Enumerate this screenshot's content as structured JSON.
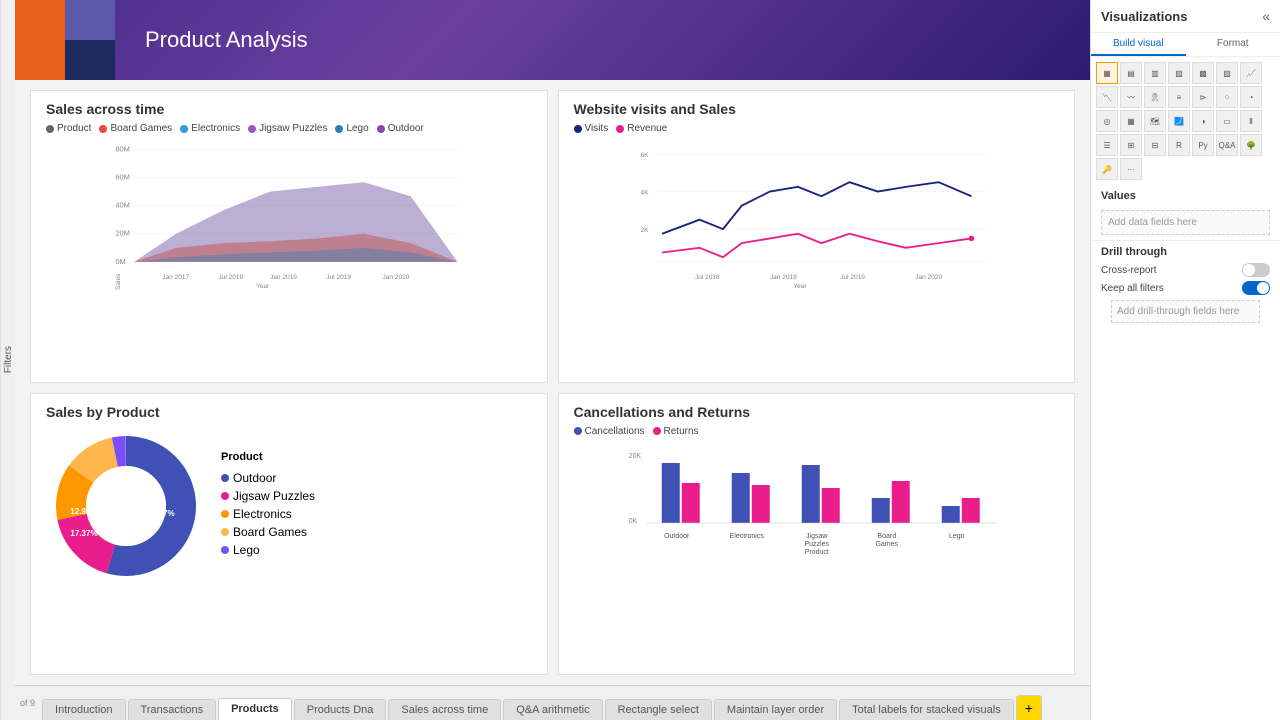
{
  "header": {
    "title": "Product Analysis"
  },
  "dashboard": {
    "charts": [
      {
        "id": "sales-time",
        "title": "Sales across time",
        "legend": [
          {
            "label": "Product",
            "color": "#666"
          },
          {
            "label": "Board Games",
            "color": "#e74c3c"
          },
          {
            "label": "Electronics",
            "color": "#3498db"
          },
          {
            "label": "Jigsaw Puzzles",
            "color": "#9b59b6"
          },
          {
            "label": "Lego",
            "color": "#2980b9"
          },
          {
            "label": "Outdoor",
            "color": "#8e44ad"
          }
        ]
      },
      {
        "id": "website-visits",
        "title": "Website visits and Sales",
        "legend": [
          {
            "label": "Visits",
            "color": "#1a237e"
          },
          {
            "label": "Revenue",
            "color": "#e91e8c"
          }
        ]
      },
      {
        "id": "sales-product",
        "title": "Sales by Product",
        "slices": [
          {
            "label": "Outdoor",
            "color": "#3f51b5",
            "value": 54.67,
            "pct": "54.67%"
          },
          {
            "label": "Jigsaw Puzzles",
            "color": "#e91e8c",
            "value": 17.37,
            "pct": "17.37%"
          },
          {
            "label": "Electronics",
            "color": "#ff9800",
            "value": 12.98,
            "pct": "12.98%"
          },
          {
            "label": "Board Games",
            "color": "#ffb74d",
            "value": 11.96,
            "pct": "11.96%"
          },
          {
            "label": "Lego",
            "color": "#7c4dff",
            "value": 2.02,
            "pct": "2.02%"
          }
        ],
        "legend_title": "Product"
      },
      {
        "id": "cancellations",
        "title": "Cancellations and Returns",
        "legend": [
          {
            "label": "Cancellations",
            "color": "#3f51b5"
          },
          {
            "label": "Returns",
            "color": "#e91e8c"
          }
        ],
        "bars": [
          {
            "label": "Outdoor",
            "cancel": 80,
            "returns": 45
          },
          {
            "label": "Electronics",
            "cancel": 55,
            "returns": 40
          },
          {
            "label": "Jigsaw Puzzles Product",
            "cancel": 65,
            "returns": 35
          },
          {
            "label": "Board Games",
            "cancel": 30,
            "returns": 50
          },
          {
            "label": "Lego",
            "cancel": 20,
            "returns": 30
          }
        ]
      }
    ]
  },
  "visualizations": {
    "title": "Visualizations",
    "tabs": [
      {
        "label": "Build visual",
        "active": true
      },
      {
        "label": "Format",
        "active": false
      }
    ],
    "sections": {
      "values_label": "Values",
      "values_placeholder": "Add data fields here",
      "drill_title": "Drill through",
      "cross_report_label": "Cross-report",
      "cross_report_state": "off",
      "keep_all_filters_label": "Keep all filters",
      "keep_all_filters_state": "on",
      "add_drill_label": "Add drill-through fields here"
    }
  },
  "tabs": {
    "items": [
      {
        "label": "Introduction",
        "active": false
      },
      {
        "label": "Transactions",
        "active": false
      },
      {
        "label": "Products",
        "active": true
      },
      {
        "label": "Products Dna",
        "active": false
      },
      {
        "label": "Sales across time",
        "active": false
      },
      {
        "label": "Q&A arithmetic",
        "active": false
      },
      {
        "label": "Rectangle select",
        "active": false
      },
      {
        "label": "Maintain layer order",
        "active": false
      },
      {
        "label": "Total labels for stacked visuals",
        "active": false
      }
    ],
    "add_label": "+"
  },
  "filters_side": {
    "label": "Filters"
  },
  "page_info": "of 9"
}
